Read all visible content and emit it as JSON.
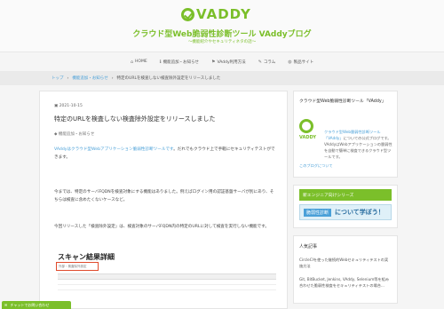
{
  "brand": {
    "logo_text": "VADDY",
    "accent": "#7bbf2a",
    "link_color": "#4aa0d8"
  },
  "site": {
    "title": "クラウド型Web脆弱性診断ツール VAddyブログ",
    "subtitle": "〜機能紹介やセキュリティネタの話〜"
  },
  "nav": [
    {
      "icon": "home-icon",
      "label": "HOME"
    },
    {
      "icon": "info-icon",
      "label": "機能追加・お知らせ"
    },
    {
      "icon": "flag-icon",
      "label": "VAddy利用方法"
    },
    {
      "icon": "pen-icon",
      "label": "コラム"
    },
    {
      "icon": "globe-icon",
      "label": "製品サイト"
    }
  ],
  "breadcrumb": [
    "トップ",
    "機能追加・お知らせ",
    "特定のURLを検査しない検査除外設定をリリースしました"
  ],
  "post": {
    "date": "2021-10-15",
    "title": "特定のURLを検査しない検査除外設定をリリースしました",
    "category": "機能追加・お知らせ",
    "p1_link": "VAddyはクラウド型Webアプリケーション脆弱性診断ツールです",
    "p1_rest": "。だれでもクラウド上で手軽にセキュリティテストができます。",
    "p2": "今までは、特定のサーバFQDNを検査対象にする機能はありました。例えばログイン用の認証基盤サーバが別にあり、そちらは検査に含めたくないケースなど。",
    "p3": "今回リリースした「検査除外設定」は、検査対象のサーバFQDN内の特定のURLに対して検査を実行しない機能です。",
    "scan_title": "スキャン結果詳細",
    "scan_input": "外部・検査除外設定"
  },
  "sidebar": {
    "about_title": "クラウド型Web脆弱性診断ツール「VAddy」",
    "logo_word": "VADDY",
    "desc_link": "クラウド型Web脆弱性診断ツール「VAddy」",
    "desc_rest": "についての公式ブログです。VAddyはWebアプリケーションの脆弱性を自動で簡単に検査できるクラウド型ツールです。",
    "more": "このブログについて",
    "promo_head": "新エンジニア向けシリーズ",
    "promo_badge": "脆弱性診断",
    "promo_text": "について学ぼう！",
    "popular_title": "人気記事",
    "popular_items": [
      "CircleCIを使った継続的Webセキュリティテストの実施方法",
      "Git, BitBucket, Jenkins, VAddy, Selenium等を組み合わせた脆弱性検査をセキュリティテストの場合..."
    ]
  },
  "chat": {
    "label": "チャットでお問い合わせ"
  }
}
